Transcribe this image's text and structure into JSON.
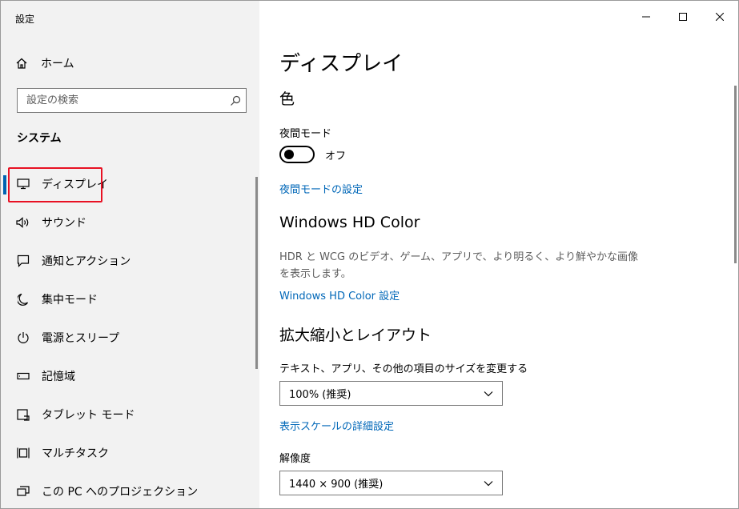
{
  "window": {
    "title": "設定"
  },
  "titlebar": {
    "minimize_icon": "minimize-icon",
    "maximize_icon": "maximize-icon",
    "close_icon": "close-icon"
  },
  "sidebar": {
    "home_label": "ホーム",
    "search": {
      "placeholder": "設定の検索"
    },
    "section_title": "システム",
    "items": [
      {
        "label": "ディスプレイ",
        "icon": "monitor-icon",
        "active": true
      },
      {
        "label": "サウンド",
        "icon": "speaker-icon"
      },
      {
        "label": "通知とアクション",
        "icon": "notification-icon"
      },
      {
        "label": "集中モード",
        "icon": "moon-icon"
      },
      {
        "label": "電源とスリープ",
        "icon": "power-icon"
      },
      {
        "label": "記憶域",
        "icon": "storage-icon"
      },
      {
        "label": "タブレット モード",
        "icon": "tablet-icon"
      },
      {
        "label": "マルチタスク",
        "icon": "multitask-icon"
      },
      {
        "label": "この PC へのプロジェクション",
        "icon": "projection-icon"
      }
    ]
  },
  "main": {
    "title": "ディスプレイ",
    "color_heading": "色",
    "night_mode": {
      "label": "夜間モード",
      "state": "オフ",
      "link": "夜間モードの設定"
    },
    "hd_color": {
      "heading": "Windows HD Color",
      "description": "HDR と WCG のビデオ、ゲーム、アプリで、より明るく、より鮮やかな画像を表示します。",
      "link": "Windows HD Color 設定"
    },
    "scale_layout": {
      "heading": "拡大縮小とレイアウト",
      "size_label": "テキスト、アプリ、その他の項目のサイズを変更する",
      "size_value": "100% (推奨)",
      "advanced_link": "表示スケールの詳細設定",
      "resolution_label": "解像度",
      "resolution_value": "1440 × 900 (推奨)"
    }
  },
  "colors": {
    "accent": "#0063b1",
    "link": "#0067b8",
    "highlight": "#e81123",
    "sidebar_bg": "#f2f2f2"
  }
}
